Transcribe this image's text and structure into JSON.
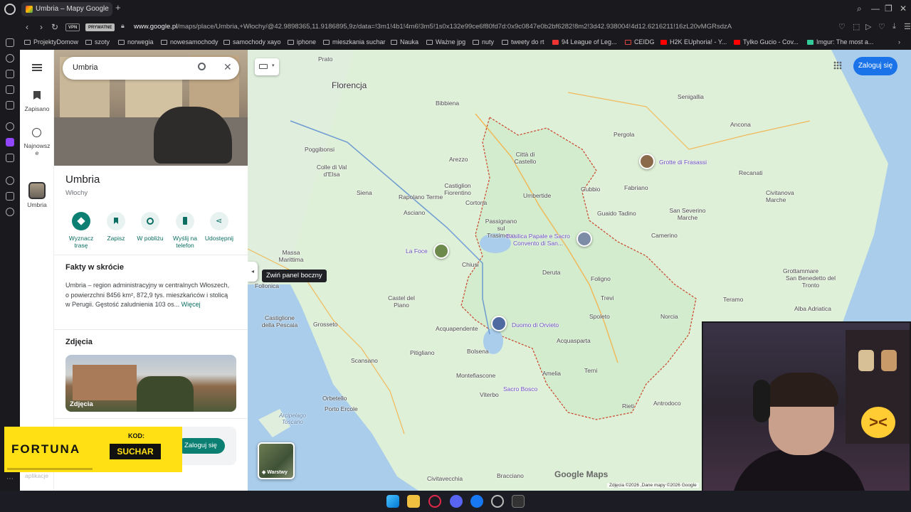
{
  "browser": {
    "tab_title": "Umbria – Mapy Google",
    "new_tab": "+",
    "vpn": "VPN",
    "private": "PRYWATNE",
    "url_domain": "www.google.pl",
    "url_path": "/maps/place/Umbria,+Włochy/@42.9898365,11.9186895,9z/data=!3m1!4b1!4m6!3m5!1s0x132e99ce6f80fd7d:0x9c0847e0b2bf6282!8m2!3d42.938004!4d12.6216211!16zL20vMGRsdzA",
    "bookmarks": [
      "ProjektyDomow",
      "szoty",
      "norwegia",
      "nowesamochody",
      "samochody xayo",
      "iphone",
      "mieszkania suchar",
      "Nauka",
      "Ważne jpg",
      "nuty",
      "tweety do rt",
      "94 League of Leg...",
      "CEIDG",
      "H2K EUphoria! - Y...",
      "Tylko Gucio - Cov...",
      "Imgur: The most a..."
    ]
  },
  "rail": {
    "saved": "Zapisano",
    "recent": "Najnowsz e",
    "place": "Umbria"
  },
  "panel": {
    "search_value": "Umbria",
    "title": "Umbria",
    "subtitle": "Włochy",
    "actions": [
      "Wyznacz trasę",
      "Zapisz",
      "W pobliżu",
      "Wyślij na telefon",
      "Udostępnij"
    ],
    "facts_title": "Fakty w skrócie",
    "facts_text": "Umbria – region administracyjny w centralnych Włoszech, o powierzchni 8456 km², 872,9 tys. mieszkańców i stolicą w Perugii. Gęstość zaludnienia 103 os...",
    "facts_more": "Więcej",
    "photos_title": "Zdjęcia",
    "photo_label": "Zdjęcia",
    "login_button": "Zaloguj się"
  },
  "map": {
    "signin": "Zaloguj się",
    "tooltip": "Zwiń panel boczny",
    "layers": "Warstwy",
    "logo": "Google Maps",
    "copyright": "Zdjęcia ©2026 ,Dane mapy ©2026 Google",
    "city": "Florencja",
    "labels": [
      "Prato",
      "Bibbiena",
      "Arezzo",
      "Città di Castello",
      "Umbertide",
      "Gubbio",
      "Pergola",
      "Senigallia",
      "Ancona",
      "Fabriano",
      "Recanati",
      "Civitanova Marche",
      "San Severino Marche",
      "Camerino",
      "Poggibonsi",
      "Colle di Val d'Elsa",
      "Siena",
      "Rapolano Terme",
      "Castiglion Fiorentino",
      "Cortona",
      "Asciano",
      "Passignano sul Trasimeno",
      "Guaido Tadino",
      "Massa Marittima",
      "Chiusi",
      "Deruta",
      "Foligno",
      "Follonica",
      "Castel del Piano",
      "Spoleto",
      "Trevi",
      "Castiglione della Pescaia",
      "Grosseto",
      "Acquapendente",
      "Acquasparta",
      "Norcia",
      "Scansano",
      "Bolsena",
      "Montefiascone",
      "Amelia",
      "Terni",
      "Pitigliano",
      "Orbetello",
      "Viterbo",
      "Rieti",
      "Antrodoco",
      "Porto Ercole",
      "Civitavecchia",
      "Bracciano",
      "Grottammare",
      "San Benedetto del Tronto",
      "Teramo",
      "Alba Adriatica"
    ],
    "pois": [
      "Grotte di Frasassi",
      "Basilica Papale e Sacro Convento di San...",
      "La Foce",
      "Duomo di Orvieto",
      "Sacro Bosco"
    ],
    "sea": [
      "Arcipelago Toscano"
    ]
  },
  "ad": {
    "brand": "FORTUNA",
    "kod": "KOD:",
    "code": "SUCHAR",
    "aplikacje": "aplikacje"
  }
}
